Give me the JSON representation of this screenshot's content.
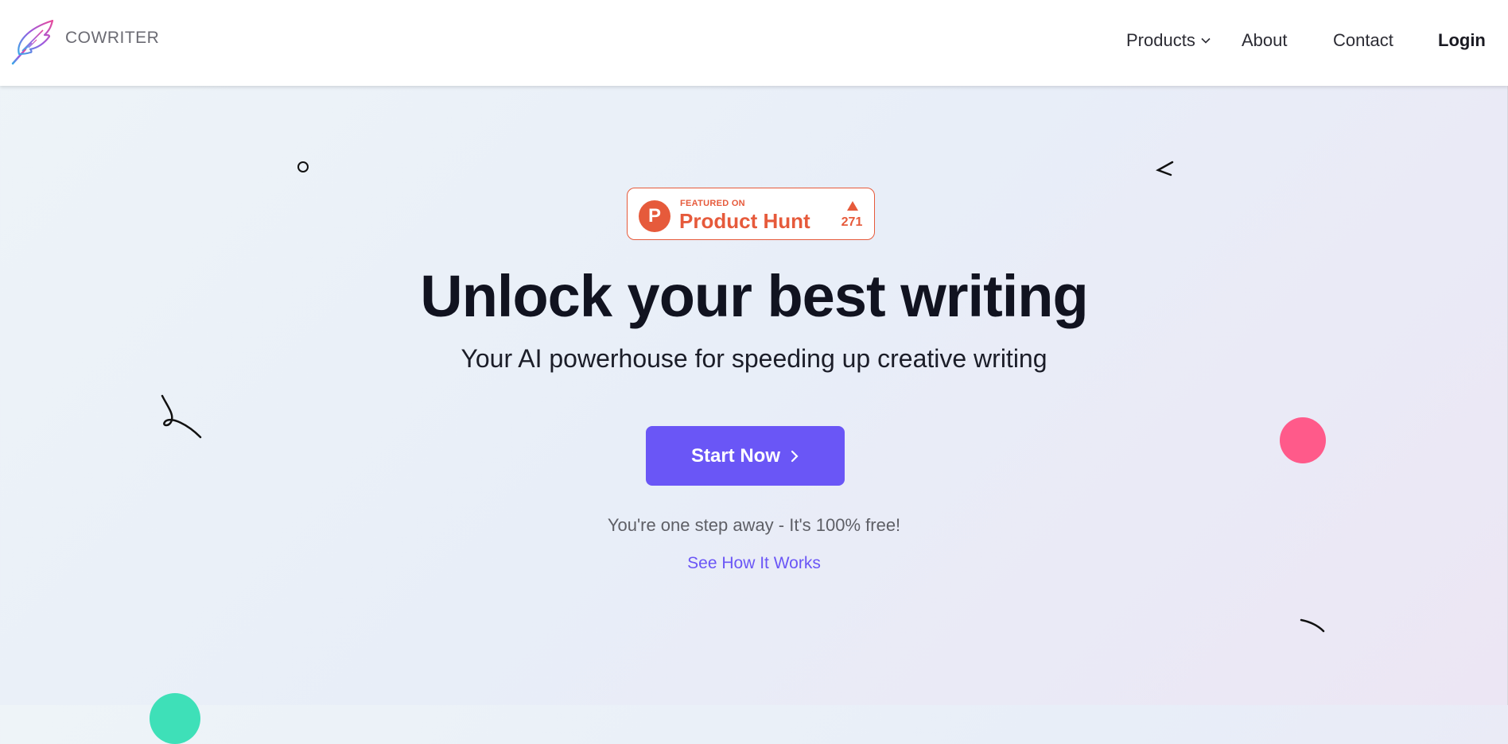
{
  "brand": {
    "name": "COWRITER",
    "icon": "feather-quill-icon"
  },
  "nav": {
    "items": [
      {
        "label": "Products",
        "has_dropdown": true,
        "icon": "chevron-down-icon"
      },
      {
        "label": "About"
      },
      {
        "label": "Contact"
      },
      {
        "label": "Login",
        "bold": true
      }
    ]
  },
  "product_hunt": {
    "featured_label": "FEATURED ON",
    "name": "Product Hunt",
    "logo_letter": "P",
    "upvotes": "271",
    "color": "#e65a3b"
  },
  "hero": {
    "title": "Unlock your best writing",
    "subtitle": "Your AI powerhouse for speeding up creative writing",
    "cta_label": "Start Now",
    "note": "You're one step away - It's 100% free!",
    "secondary_link": "See How It Works"
  },
  "colors": {
    "accent": "#6a56f6",
    "pink_decoration": "#ff5a8a",
    "teal_decoration": "#3ee0b8",
    "title": "#111320"
  }
}
